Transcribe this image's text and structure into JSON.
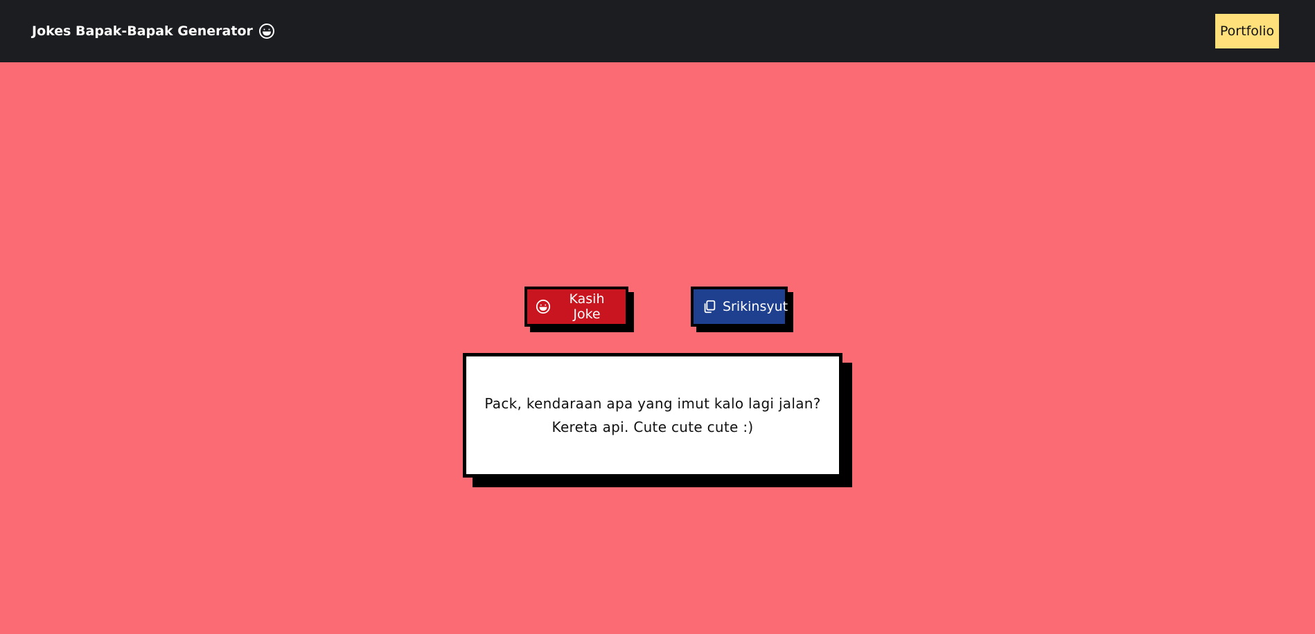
{
  "navbar": {
    "title": "Jokes Bapak-Bapak Generator",
    "title_icon": "grin-icon",
    "portfolio_label": "Portfolio"
  },
  "actions": {
    "joke_button": {
      "label": "Kasih Joke",
      "icon": "grin-icon"
    },
    "copy_button": {
      "label": "Srikinsyut",
      "icon": "copy-icon"
    }
  },
  "joke": {
    "question": "Pack, kendaraan apa yang imut kalo lagi jalan?",
    "answer": "Kereta api. Cute cute cute :)"
  },
  "colors": {
    "background": "#fb6b74",
    "navbar": "#1c1d21",
    "portfolio_button": "#ffe07a",
    "joke_button": "#c8151f",
    "copy_button": "#1f3f8f",
    "card": "#ffffff",
    "shadow": "#000000"
  }
}
